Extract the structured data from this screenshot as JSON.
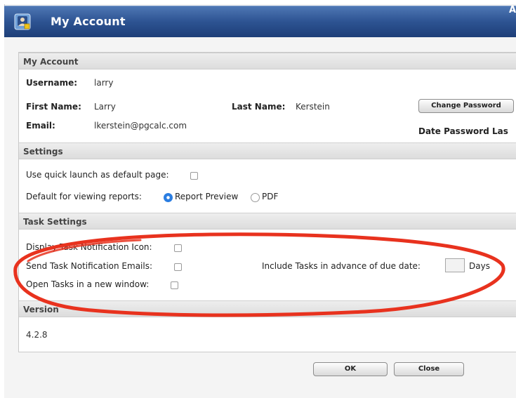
{
  "window": {
    "title": "My Account",
    "corner_mark": "A"
  },
  "account": {
    "header": "My Account",
    "username_label": "Username:",
    "username_value": "larry",
    "first_name_label": "First Name:",
    "first_name_value": "Larry",
    "last_name_label": "Last Name:",
    "last_name_value": "Kerstein",
    "email_label": "Email:",
    "email_value": "lkerstein@pgcalc.com",
    "change_password_label": "Change Password",
    "date_password_label": "Date Password Las"
  },
  "settings": {
    "header": "Settings",
    "quick_launch_label": "Use quick launch as default page:",
    "quick_launch_checked": false,
    "view_reports_label": "Default for viewing reports:",
    "report_preview_label": "Report Preview",
    "report_preview_selected": true,
    "pdf_label": "PDF",
    "pdf_selected": false
  },
  "task_settings": {
    "header": "Task Settings",
    "display_icon_label": "Display Task Notification Icon:",
    "display_icon_checked": false,
    "send_emails_label": "Send Task Notification Emails:",
    "send_emails_checked": false,
    "open_new_window_label": "Open Tasks in a new window:",
    "open_new_window_checked": false,
    "advance_label": "Include Tasks in advance of due date:",
    "advance_value": "",
    "days_label": "Days"
  },
  "version": {
    "header": "Version",
    "number": "4.2.8"
  },
  "footer": {
    "ok_label": "OK",
    "close_label": "Close"
  },
  "colors": {
    "titlebar": "#2d5392",
    "annotation_ellipse": "#e8321e",
    "radio_selected": "#2a7de1"
  }
}
